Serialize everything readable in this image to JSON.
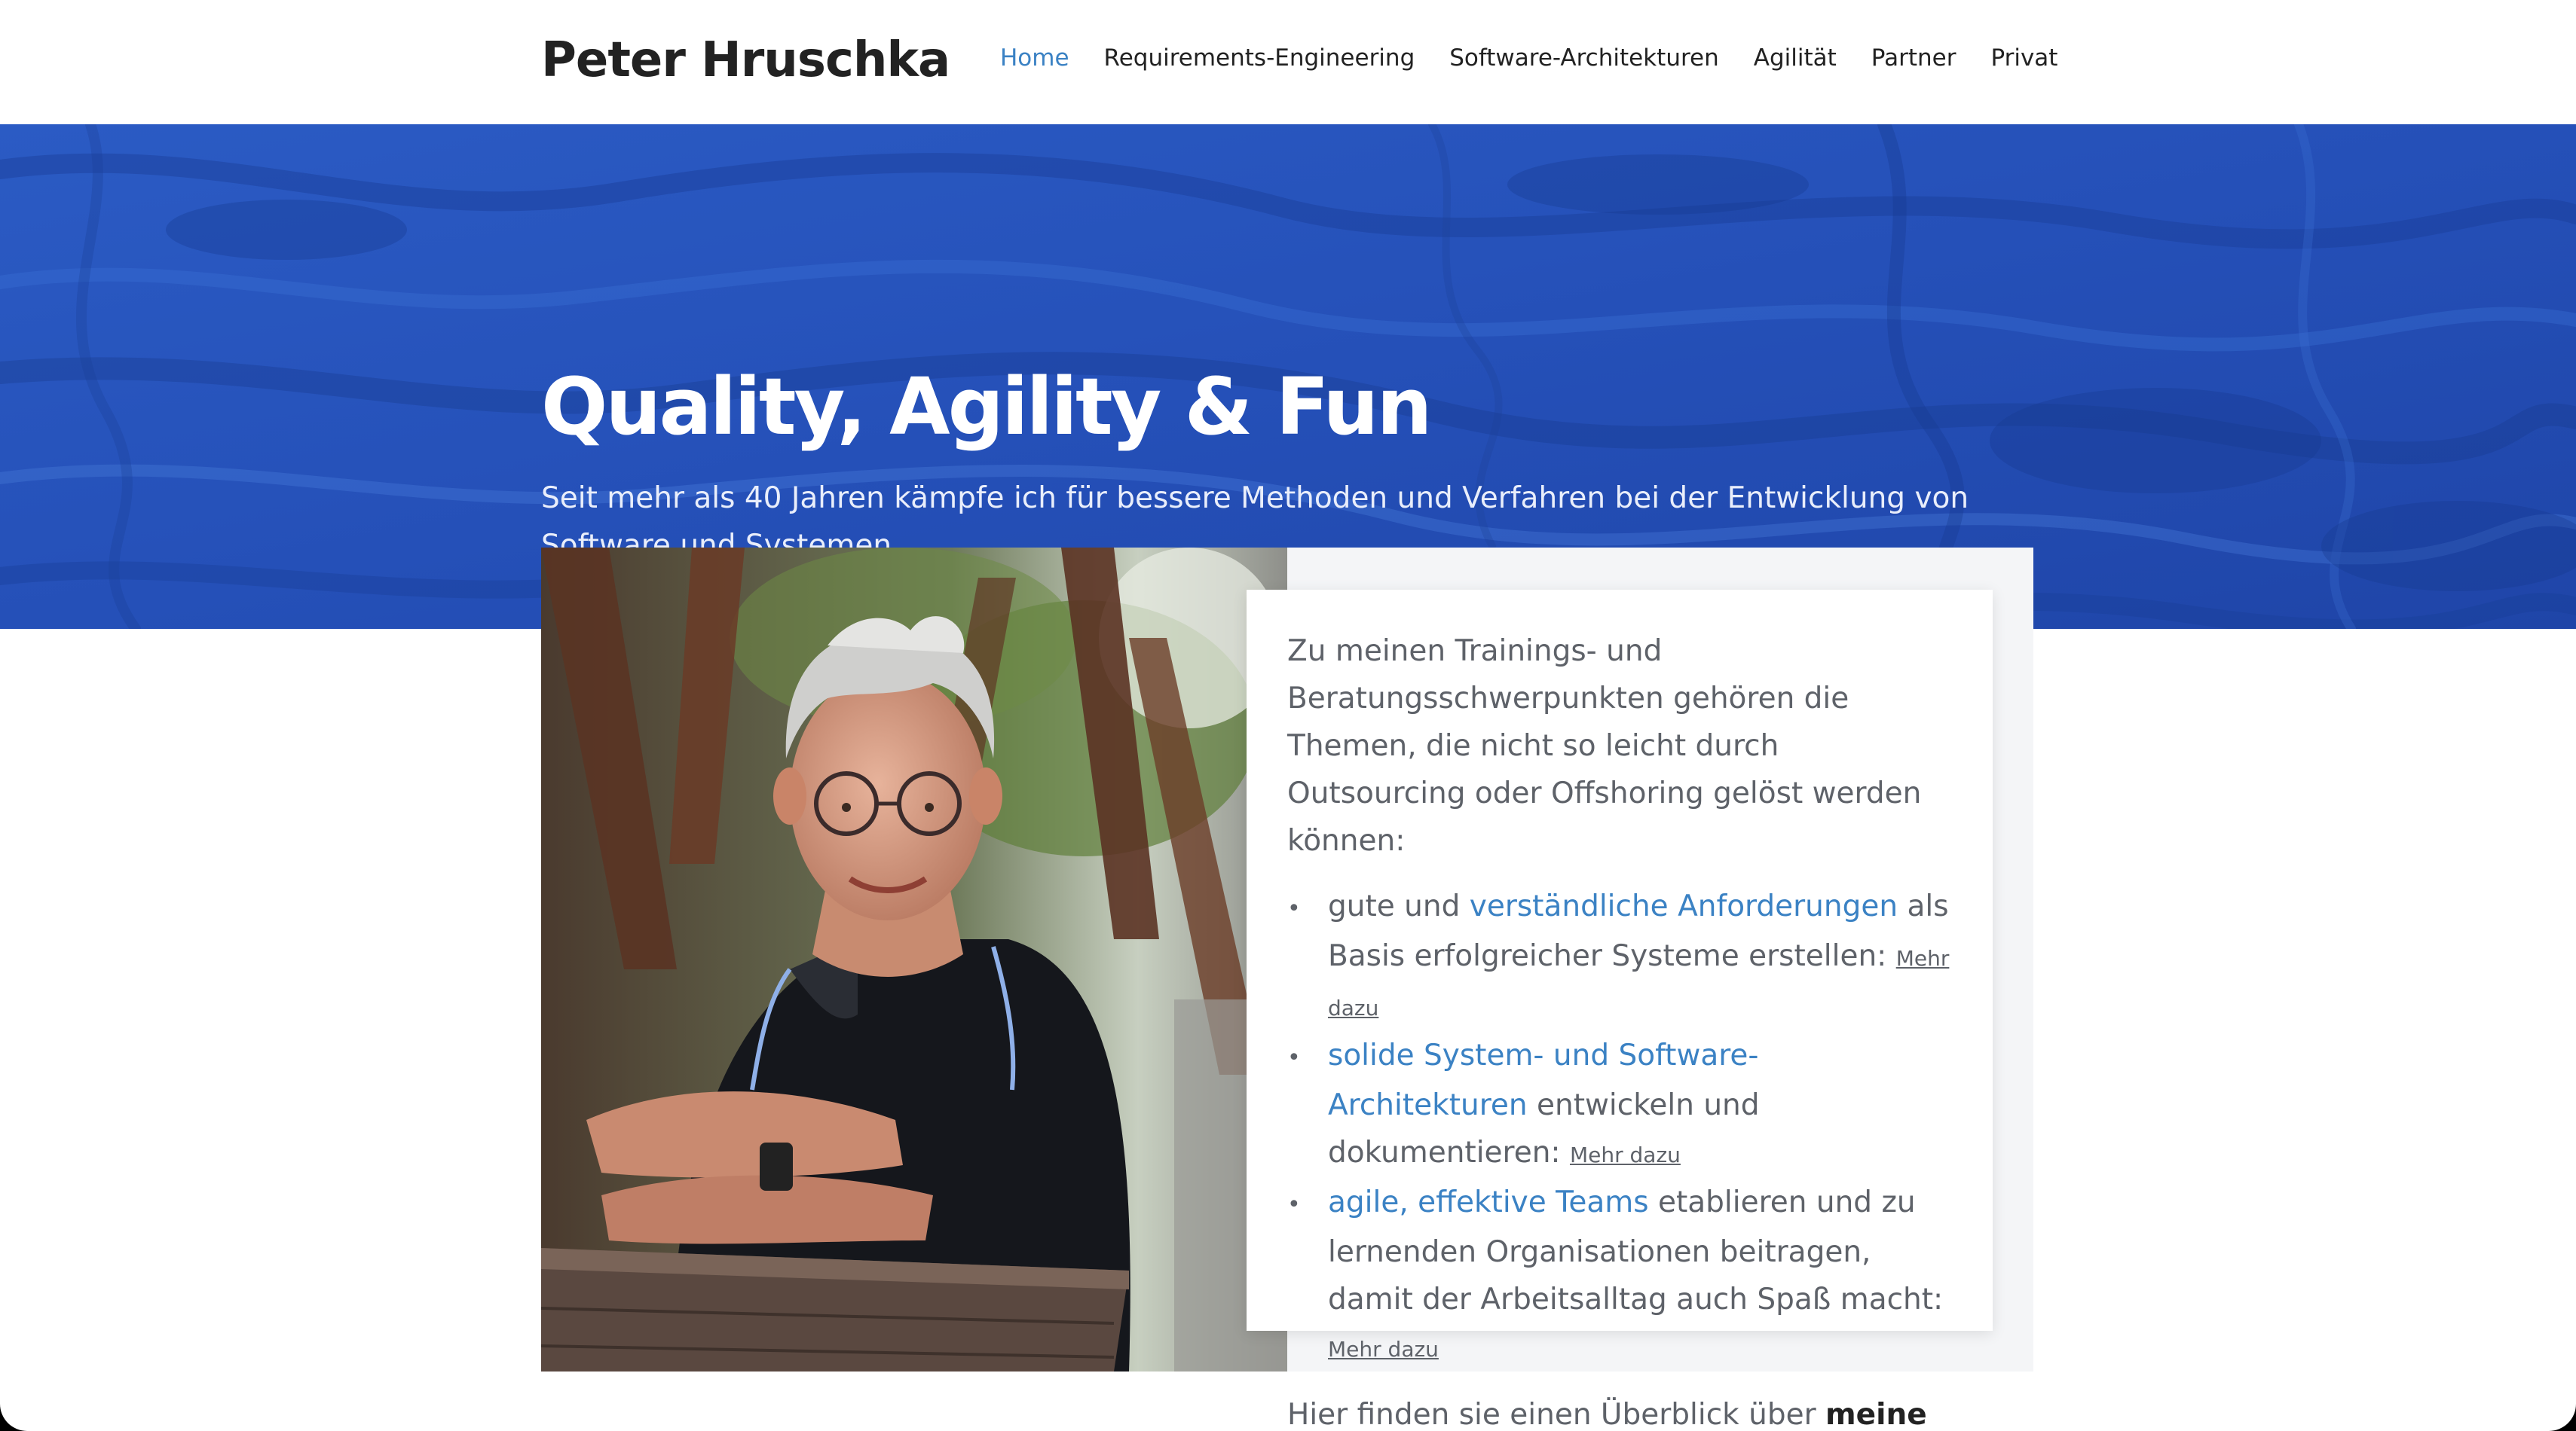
{
  "header": {
    "site_title": "Peter Hruschka",
    "nav": [
      {
        "label": "Home",
        "active": true
      },
      {
        "label": "Requirements-Engineering",
        "active": false
      },
      {
        "label": "Software-Architekturen",
        "active": false
      },
      {
        "label": "Agilität",
        "active": false
      },
      {
        "label": "Partner",
        "active": false
      },
      {
        "label": "Privat",
        "active": false
      }
    ]
  },
  "hero": {
    "title": "Quality, Agility & Fun",
    "subtitle": "Seit mehr als 40 Jahren kämpfe ich für bessere Methoden und Verfahren bei der Entwicklung von Software und Systemen."
  },
  "intro": {
    "paragraph": "Zu meinen Trainings- und Beratungsschwerpunkten gehören die Themen, die nicht so leicht durch Outsourcing oder Offshoring gelöst werden können:",
    "items": [
      {
        "pre": "gute und ",
        "link": "verständliche Anforderungen",
        "post": " als Basis erfolgreicher Systeme erstellen: ",
        "more": "Mehr dazu"
      },
      {
        "pre": "",
        "link": "solide System- und Software-Architekturen",
        "post": " entwickeln und dokumentieren: ",
        "more": "Mehr dazu"
      },
      {
        "pre": "",
        "link": "agile, effektive Teams",
        "post": " etablieren und zu lernenden Organisationen beitragen, damit der Arbeitsalltag auch Spaß macht: ",
        "more": "Mehr dazu"
      }
    ],
    "overview_text": "Hier finden sie einen Überblick über ",
    "overview_link": "meine Dienstleistungen"
  },
  "colors": {
    "accent": "#3b82c4",
    "hero_blue": "#2a56bb",
    "text": "#5e6269"
  },
  "icons": {
    "bullet": "•"
  }
}
